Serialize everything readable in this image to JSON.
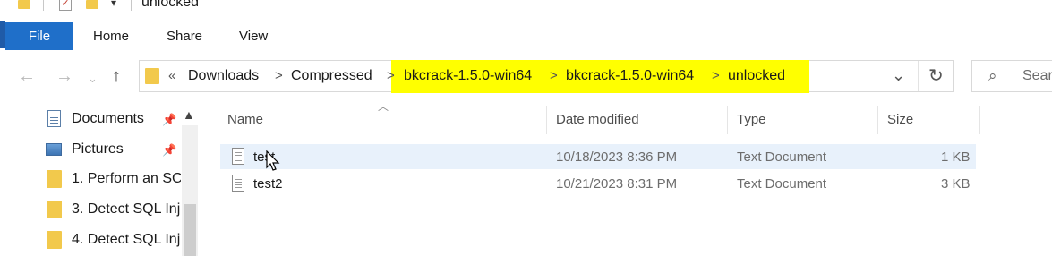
{
  "window": {
    "title": "unlocked"
  },
  "ribbon": {
    "file_label": "File",
    "tabs": [
      "Home",
      "Share",
      "View"
    ]
  },
  "address": {
    "overflow_chevron": "«",
    "separator": ">",
    "crumbs": [
      "Downloads",
      "Compressed",
      "bkcrack-1.5.0-win64",
      "bkcrack-1.5.0-win64",
      "unlocked"
    ],
    "highlight_color": "#ffff00"
  },
  "search": {
    "placeholder": "Sear"
  },
  "sidebar": {
    "items": [
      {
        "label": "Documents",
        "icon": "documents-icon",
        "pinned": true
      },
      {
        "label": "Pictures",
        "icon": "pictures-icon",
        "pinned": true
      },
      {
        "label": "1. Perform an SC",
        "icon": "folder-icon",
        "pinned": false
      },
      {
        "label": "3. Detect SQL Inj",
        "icon": "folder-icon",
        "pinned": false
      },
      {
        "label": "4. Detect SQL Inj",
        "icon": "folder-icon",
        "pinned": false
      }
    ]
  },
  "file_list": {
    "columns": [
      "Name",
      "Date modified",
      "Type",
      "Size"
    ],
    "rows": [
      {
        "name": "test",
        "date": "10/18/2023 8:36 PM",
        "type": "Text Document",
        "size": "1 KB",
        "hovered": true
      },
      {
        "name": "test2",
        "date": "10/21/2023 8:31 PM",
        "type": "Text Document",
        "size": "3 KB",
        "hovered": false
      }
    ]
  },
  "colors": {
    "accent": "#1f6fc9",
    "folder": "#f2c94c",
    "hover_row": "#e8f1fb"
  }
}
